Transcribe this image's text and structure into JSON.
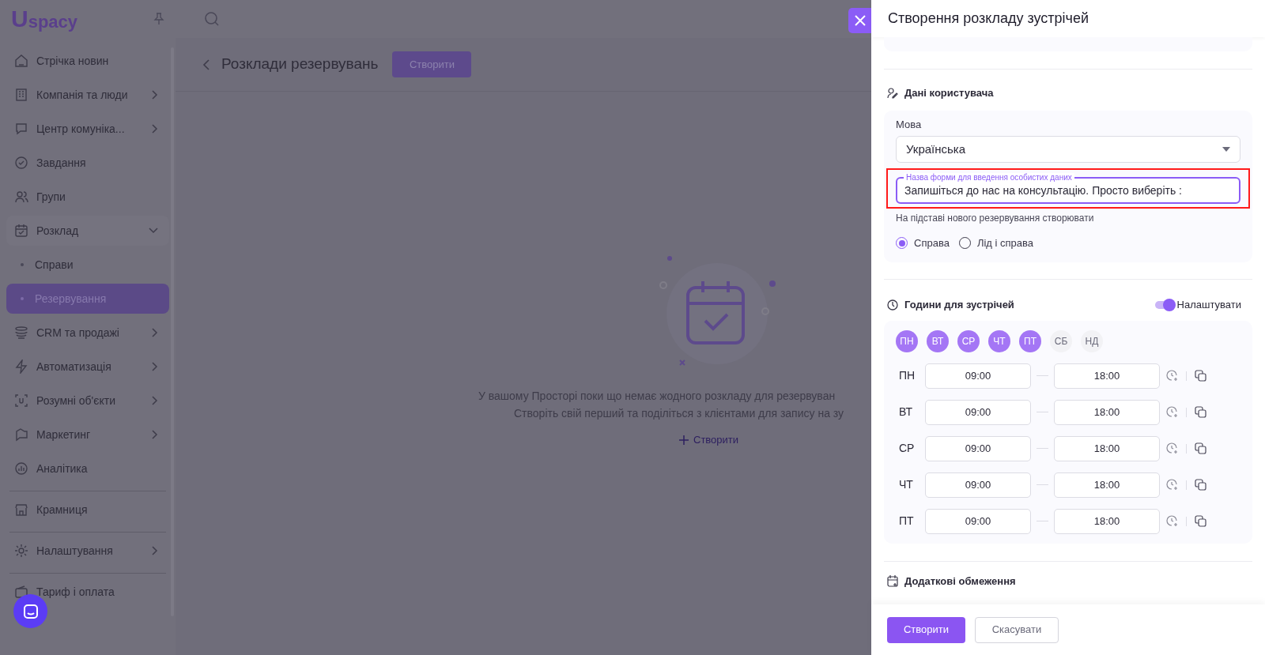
{
  "sidebar": {
    "logo": {
      "mark": "U",
      "text": "spacy"
    },
    "items": [
      {
        "kind": "item",
        "label": "Стрічка новин",
        "expandable": false,
        "expanded": false,
        "selected": false
      },
      {
        "kind": "item",
        "label": "Компанія та люди",
        "expandable": true,
        "expanded": false,
        "selected": false
      },
      {
        "kind": "item",
        "label": "Центр комуніка...",
        "expandable": true,
        "expanded": false,
        "selected": false
      },
      {
        "kind": "item",
        "label": "Завдання",
        "expandable": false,
        "expanded": false,
        "selected": false
      },
      {
        "kind": "item",
        "label": "Групи",
        "expandable": false,
        "expanded": false,
        "selected": false
      },
      {
        "kind": "item",
        "label": "Розклад",
        "expandable": true,
        "expanded": true,
        "selected": false
      },
      {
        "kind": "subitem",
        "label": "Справи",
        "expandable": false,
        "expanded": false,
        "selected": false
      },
      {
        "kind": "subitem",
        "label": "Резервування",
        "expandable": false,
        "expanded": false,
        "selected": true
      },
      {
        "kind": "item",
        "label": "CRM та продажі",
        "expandable": true,
        "expanded": false,
        "selected": false
      },
      {
        "kind": "item",
        "label": "Автоматизація",
        "expandable": true,
        "expanded": false,
        "selected": false
      },
      {
        "kind": "item",
        "label": "Розумні об'єкти",
        "expandable": true,
        "expanded": false,
        "selected": false
      },
      {
        "kind": "item",
        "label": "Маркетинг",
        "expandable": true,
        "expanded": false,
        "selected": false
      },
      {
        "kind": "item",
        "label": "Аналітика",
        "expandable": false,
        "expanded": false,
        "selected": false
      },
      {
        "kind": "divider"
      },
      {
        "kind": "item",
        "label": "Крамниця",
        "expandable": false,
        "expanded": false,
        "selected": false
      },
      {
        "kind": "divider"
      },
      {
        "kind": "item",
        "label": "Налаштування",
        "expandable": true,
        "expanded": false,
        "selected": false
      },
      {
        "kind": "divider"
      },
      {
        "kind": "item",
        "label": "Тариф і оплата",
        "expandable": false,
        "expanded": false,
        "selected": false
      }
    ]
  },
  "page": {
    "title": "Розклади резервувань",
    "create_button": "Створити",
    "empty_state": {
      "lines": [
        "У вашому Просторі поки що немає жодного розкладу для резервуван",
        "Створіть свій перший та поділіться з клієнтами для запису на зу"
      ],
      "action": "Створити"
    }
  },
  "drawer": {
    "title": "Створення розкладу зустрічей",
    "user_data": {
      "heading": "Дані користувача",
      "language_label": "Мова",
      "language_value": "Українська",
      "form_name": {
        "label": "Назва форми для введення особистих даних",
        "value": "Запишіться до нас на консультацію. Просто виберіть :",
        "highlighted": true
      },
      "create_label": "На підставі нового резервування створювати",
      "options": [
        {
          "label": "Справа",
          "selected": true
        },
        {
          "label": "Лід і справа",
          "selected": false
        }
      ]
    },
    "hours": {
      "heading": "Години для зустрічей",
      "toggle": {
        "label": "Налаштувати",
        "on": true
      },
      "days": [
        {
          "label": "ПН",
          "selected": true
        },
        {
          "label": "ВТ",
          "selected": true
        },
        {
          "label": "СР",
          "selected": true
        },
        {
          "label": "ЧТ",
          "selected": true
        },
        {
          "label": "ПТ",
          "selected": true
        },
        {
          "label": "СБ",
          "selected": false
        },
        {
          "label": "НД",
          "selected": false
        }
      ],
      "rows": [
        {
          "day": "ПН",
          "from": "09:00",
          "to": "18:00"
        },
        {
          "day": "ВТ",
          "from": "09:00",
          "to": "18:00"
        },
        {
          "day": "СР",
          "from": "09:00",
          "to": "18:00"
        },
        {
          "day": "ЧТ",
          "from": "09:00",
          "to": "18:00"
        },
        {
          "day": "ПТ",
          "from": "09:00",
          "to": "18:00"
        }
      ]
    },
    "limits": {
      "heading": "Додаткові обмеження"
    },
    "buttons": {
      "primary": "Створити",
      "secondary": "Скасувати"
    }
  }
}
